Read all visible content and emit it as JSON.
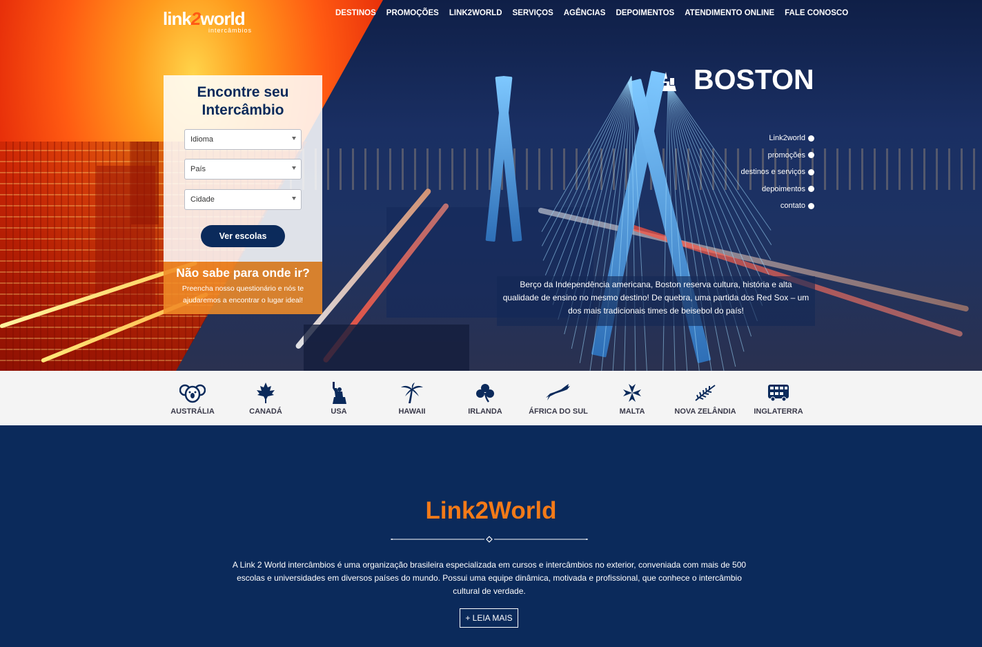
{
  "header": {
    "logo": {
      "main_prefix": "link",
      "main_two": "2",
      "main_suffix": "world",
      "sub": "intercâmbios"
    },
    "nav": [
      "DESTINOS",
      "PROMOÇÕES",
      "LINK2WORLD",
      "SERVIÇOS",
      "AGÊNCIAS",
      "DEPOIMENTOS",
      "ATENDIMENTO ONLINE",
      "FALE CONOSCO"
    ]
  },
  "search": {
    "title_line1": "Encontre seu",
    "title_line2": "Intercâmbio",
    "selects": [
      "Idioma",
      "País",
      "Cidade"
    ],
    "button": "Ver escolas"
  },
  "promo": {
    "title": "Não sabe para onde ir?",
    "text_line1": "Preencha nosso questionário e nós te",
    "text_line2": "ajudaremos a encontrar o lugar ideal!"
  },
  "hero": {
    "city": "BOSTON",
    "side_nav": [
      "Link2world",
      "promoções",
      "destinos e serviços",
      "depoimentos",
      "contato"
    ],
    "description": "Berço da Independência americana, Boston reserva cultura, história e alta qualidade de ensino no mesmo destino! De quebra, uma partida dos Red Sox – um dos mais tradicionais times de beisebol do país!"
  },
  "destinations": [
    {
      "label": "AUSTRÁLIA",
      "icon": "koala-icon"
    },
    {
      "label": "CANADÁ",
      "icon": "maple-leaf-icon"
    },
    {
      "label": "USA",
      "icon": "statue-of-liberty-icon"
    },
    {
      "label": "HAWAII",
      "icon": "palm-tree-icon"
    },
    {
      "label": "IRLANDA",
      "icon": "shamrock-icon"
    },
    {
      "label": "ÁFRICA DO SUL",
      "icon": "springbok-icon"
    },
    {
      "label": "MALTA",
      "icon": "maltese-cross-icon"
    },
    {
      "label": "NOVA ZELÂNDIA",
      "icon": "silver-fern-icon"
    },
    {
      "label": "INGLATERRA",
      "icon": "double-decker-bus-icon"
    }
  ],
  "about": {
    "title": "Link2World",
    "text": "A Link 2 World intercâmbios é uma organização brasileira especializada em cursos e intercâmbios no exterior, conveniada com mais de 500 escolas e universidades em diversos países do mundo. Possui uma equipe dinâmica, motivada e profissional, que conhece o intercâmbio cultural de verdade.",
    "button": "+ LEIA MAIS"
  },
  "colors": {
    "navy": "#0b2a5b",
    "orange": "#f37a18"
  }
}
